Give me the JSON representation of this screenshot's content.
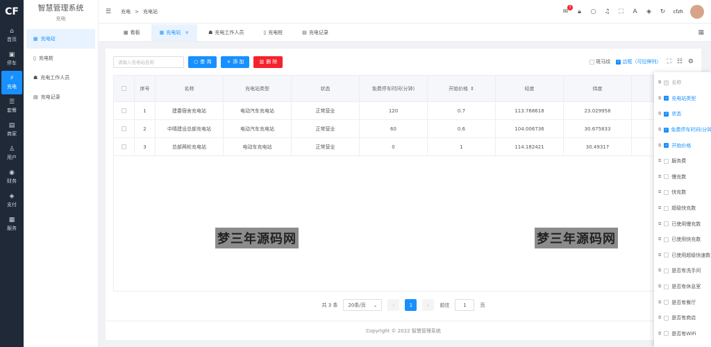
{
  "app": {
    "logo_text": "CF",
    "system_title": "智慧管理系统",
    "module_label": "充电"
  },
  "side_nav": [
    {
      "icon": "home-icon",
      "glyph": "⌂",
      "label": "首页"
    },
    {
      "icon": "parking-icon",
      "glyph": "▣",
      "label": "停车"
    },
    {
      "icon": "charging-icon",
      "glyph": "⚡",
      "label": "充电"
    },
    {
      "icon": "package-icon",
      "glyph": "☰",
      "label": "套餐"
    },
    {
      "icon": "store-icon",
      "glyph": "▤",
      "label": "商家"
    },
    {
      "icon": "user-icon",
      "glyph": "♙",
      "label": "用户"
    },
    {
      "icon": "finance-icon",
      "glyph": "◉",
      "label": "财务"
    },
    {
      "icon": "pay-icon",
      "glyph": "◈",
      "label": "支付"
    },
    {
      "icon": "service-icon",
      "glyph": "▦",
      "label": "服务"
    }
  ],
  "sub_nav": [
    {
      "label": "充电站",
      "icon": "grid-icon",
      "glyph": "▦"
    },
    {
      "label": "充电桩",
      "icon": "pile-icon",
      "glyph": "▯"
    },
    {
      "label": "充电工作人员",
      "icon": "staff-icon",
      "glyph": "☗"
    },
    {
      "label": "充电记录",
      "icon": "record-icon",
      "glyph": "▤"
    }
  ],
  "breadcrumb": {
    "parent": "充电",
    "sep": ">",
    "current": "充电站"
  },
  "header": {
    "username": "cfzh",
    "notify_count": "3"
  },
  "tabs": [
    {
      "label": "看板",
      "icon": "dashboard-icon",
      "glyph": "▦"
    },
    {
      "label": "充电站",
      "icon": "grid-icon",
      "glyph": "▦",
      "close": "×"
    },
    {
      "label": "充电工作人员",
      "icon": "staff-icon",
      "glyph": "☗"
    },
    {
      "label": "充电桩",
      "icon": "pile-icon",
      "glyph": "▯"
    },
    {
      "label": "充电记录",
      "icon": "record-icon",
      "glyph": "▤"
    }
  ],
  "toolbar": {
    "search_placeholder": "请输入充电站名称",
    "query_label": "查 询",
    "add_label": "添 加",
    "delete_label": "删 除",
    "stripe_label": "斑马纹",
    "border_label": "边框（可拉伸列）"
  },
  "table": {
    "headers": [
      "序号",
      "名称",
      "充电站类型",
      "状态",
      "免费停车时间(分钟)",
      "开始价格",
      "经度",
      "纬度"
    ],
    "rows": [
      [
        "1",
        "建委宿舍充电站",
        "电动汽车充电站",
        "正常营业",
        "120",
        "0.7",
        "113.768618",
        "23.029958"
      ],
      [
        "2",
        "中晴建设总部充电站",
        "电动汽车充电站",
        "正常营业",
        "60",
        "0.6",
        "104.006736",
        "30.675833"
      ],
      [
        "3",
        "总部两轮充电站",
        "电动车充电站",
        "正常营业",
        "0",
        "1",
        "114.182421",
        "30.49317"
      ]
    ]
  },
  "pagination": {
    "total": "共 3 条",
    "page_size": "20条/页",
    "current": "1",
    "goto_label": "前往",
    "goto_value": "1",
    "page_unit": "页"
  },
  "footer": {
    "copyright": "Copyright © 2022 智慧管理系统"
  },
  "watermark": "梦三年源码网",
  "column_panel": [
    {
      "label": "名称",
      "state": "disabled"
    },
    {
      "label": "充电站类型",
      "state": "checked"
    },
    {
      "label": "状态",
      "state": "checked"
    },
    {
      "label": "免费停车时间(分钟)",
      "state": "checked"
    },
    {
      "label": "开始价格",
      "state": "checked"
    },
    {
      "label": "服务费",
      "state": "off"
    },
    {
      "label": "慢充数",
      "state": "off"
    },
    {
      "label": "快充数",
      "state": "off"
    },
    {
      "label": "超级快充数",
      "state": "off"
    },
    {
      "label": "已使用慢充数",
      "state": "off"
    },
    {
      "label": "已使用快充数",
      "state": "off"
    },
    {
      "label": "已使用超级快速数",
      "state": "off"
    },
    {
      "label": "是否有洗手间",
      "state": "off"
    },
    {
      "label": "是否有休息室",
      "state": "off"
    },
    {
      "label": "是否有餐厅",
      "state": "off"
    },
    {
      "label": "是否有商店",
      "state": "off"
    },
    {
      "label": "是否有WiFi",
      "state": "off"
    }
  ],
  "colors": {
    "primary": "#1890ff",
    "danger": "#f5222d",
    "sidebar": "#1f2937"
  }
}
